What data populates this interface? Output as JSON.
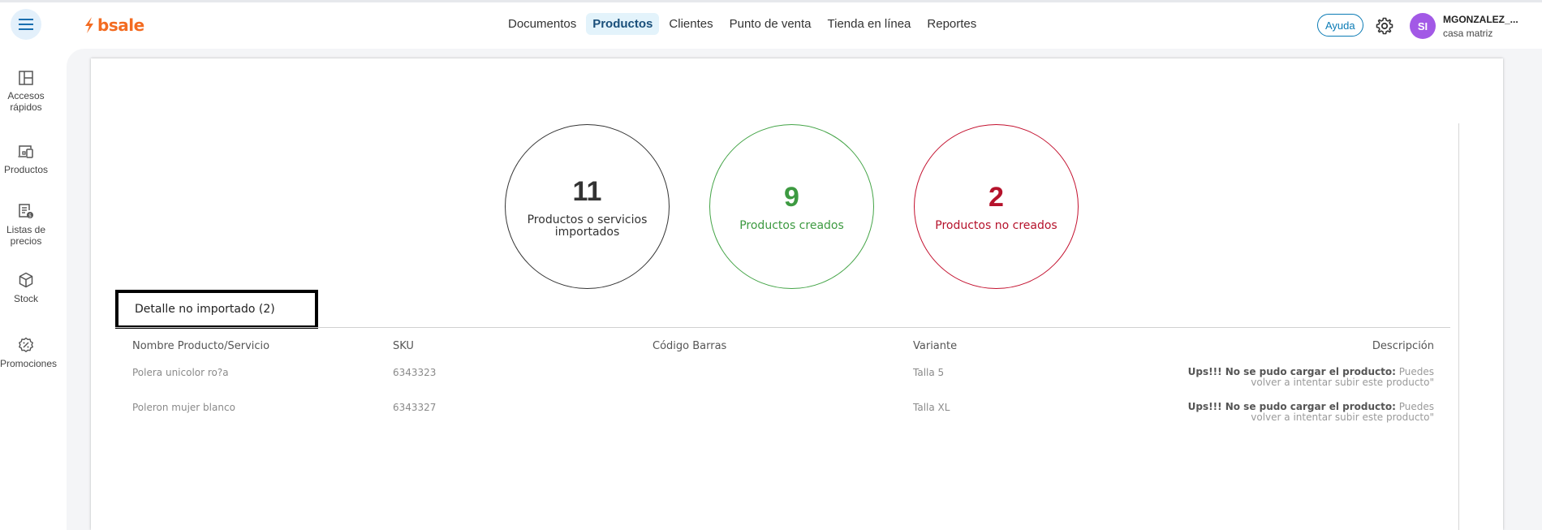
{
  "header": {
    "logo_text": "bsale",
    "nav": [
      "Documentos",
      "Productos",
      "Clientes",
      "Punto de venta",
      "Tienda en línea",
      "Reportes"
    ],
    "active_nav": "Productos",
    "help_label": "Ayuda",
    "avatar_initials": "SI",
    "user_name": "MGONZALEZ_...",
    "user_branch": "casa matriz"
  },
  "sidebar": {
    "items": [
      {
        "label": "Accesos rápidos",
        "icon": "layout-icon"
      },
      {
        "label": "Productos",
        "icon": "products-icon"
      },
      {
        "label": "Listas de precios",
        "icon": "price-list-icon"
      },
      {
        "label": "Stock",
        "icon": "box-icon"
      },
      {
        "label": "Promociones",
        "icon": "promo-badge-icon"
      }
    ]
  },
  "summary": {
    "total": {
      "value": "11",
      "label": "Productos o servicios importados",
      "color": "#333333"
    },
    "created": {
      "value": "9",
      "label": "Productos creados",
      "color": "#3d9a41"
    },
    "not_created": {
      "value": "2",
      "label": "Productos no creados",
      "color": "#b5122b"
    }
  },
  "tab_label": "Detalle no importado (2)",
  "table": {
    "headers": [
      "Nombre Producto/Servicio",
      "SKU",
      "Código Barras",
      "Variante",
      "Descripción"
    ],
    "rows": [
      {
        "name": "Polera unicolor ro?a",
        "sku": "6343323",
        "barcode": "",
        "variant": "Talla 5",
        "desc_strong": "Ups!!! No se pudo cargar el producto:",
        "desc_text": " Puedes volver a intentar subir este producto\""
      },
      {
        "name": "Poleron mujer blanco",
        "sku": "6343327",
        "barcode": "",
        "variant": "Talla XL",
        "desc_strong": "Ups!!! No se pudo cargar el producto:",
        "desc_text": " Puedes volver a intentar subir este producto\""
      }
    ]
  }
}
